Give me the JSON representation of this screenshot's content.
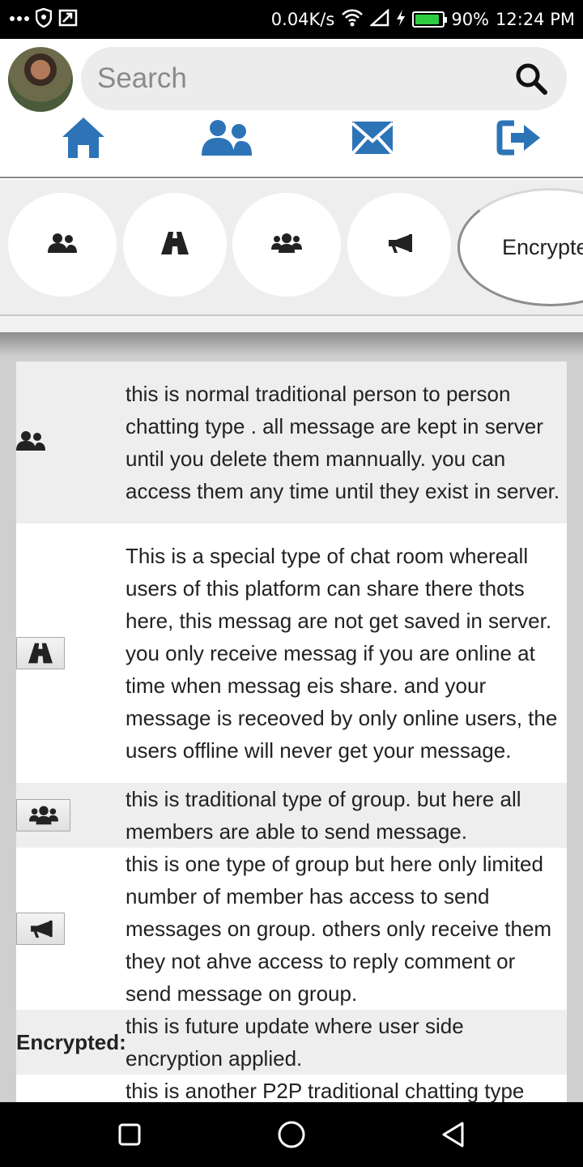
{
  "status_bar": {
    "speed": "0.04K/s",
    "battery": "90%",
    "battery_fraction": 0.9,
    "time": "12:24 PM",
    "icons": [
      "more-dots-icon",
      "shield-icon",
      "screen-cast-icon",
      "wifi-icon",
      "signal-icon",
      "charging-icon",
      "battery-icon"
    ]
  },
  "header": {
    "search_placeholder": "Search",
    "nav": [
      "home-icon",
      "users-icon",
      "envelope-icon",
      "logout-icon"
    ],
    "accent_color": "#2d74b7"
  },
  "chips": {
    "icons": [
      "user-friends-icon",
      "road-icon",
      "users-group-icon",
      "bullhorn-icon"
    ],
    "encrypted_label": "Encrypted"
  },
  "rows": [
    {
      "icon": "user-friends-icon",
      "text": "this is normal traditional person to person chatting type . all message are kept in server until you delete them mannually. you can access them any time until they exist in server."
    },
    {
      "icon": "road-icon",
      "text": "This is a special type of chat room whereall users of this platform can share there thots here, this messag are not get saved in server. you only receive messag if you are online at time when messag eis share. and your message is receoved by only online users, the users offline will never get your message."
    },
    {
      "icon": "users-group-icon",
      "text": "this is traditional type of group. but here all members are able to send message."
    },
    {
      "icon": "bullhorn-icon",
      "text": "this is one type of group but here only limited number of member has access to send messages on group. others only receive them they not ahve access to reply comment or send message on group."
    },
    {
      "label": "Encrypted:",
      "text": "this is future update where user side encryption applied."
    },
    {
      "text": "this is another P2P traditional chatting type"
    }
  ],
  "system_nav": [
    "recents-square-icon",
    "home-circle-icon",
    "back-triangle-icon"
  ]
}
